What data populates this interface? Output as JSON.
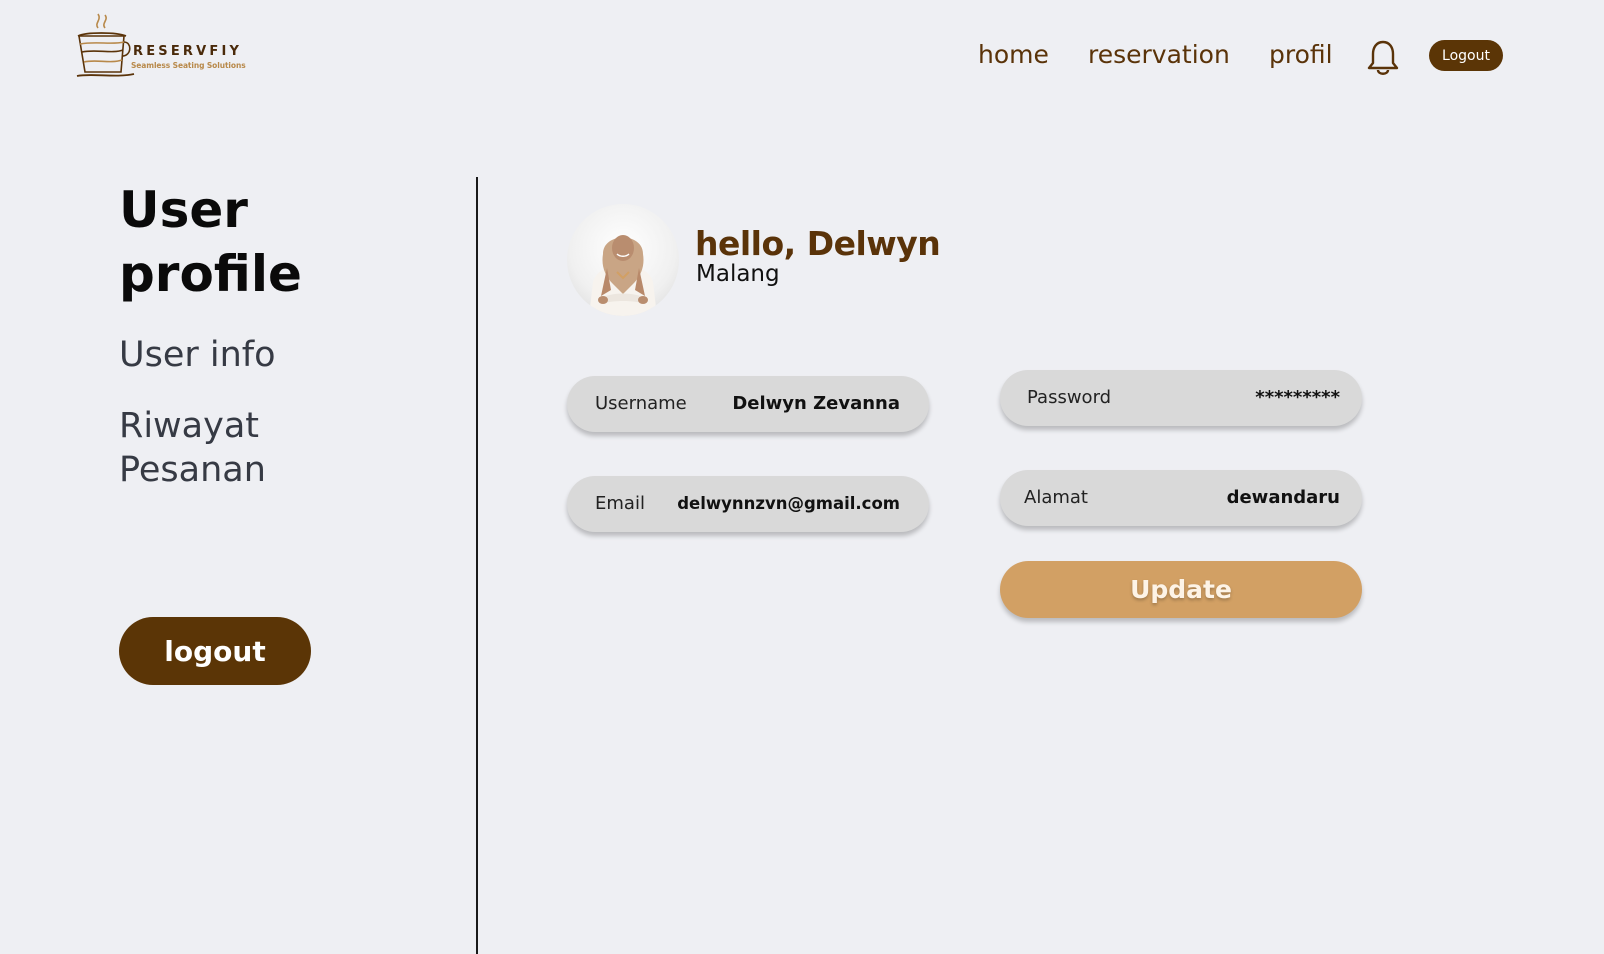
{
  "header": {
    "logo": {
      "name": "RESERVFIY",
      "tagline": "Seamless Seating Solutions"
    },
    "nav": [
      {
        "label": "home"
      },
      {
        "label": "reservation"
      },
      {
        "label": "profil"
      }
    ],
    "notification_icon": "bell-icon",
    "logout_label": "Logout"
  },
  "sidebar": {
    "title": "User profile",
    "items": [
      {
        "label": "User info"
      },
      {
        "label": "Riwayat Pesanan"
      }
    ],
    "logout_label": "logout"
  },
  "profile": {
    "greeting": "hello, Delwyn",
    "city": "Malang",
    "avatar_icon": "user-avatar-photo",
    "fields": {
      "username": {
        "label": "Username",
        "value": "Delwyn Zevanna"
      },
      "email": {
        "label": "Email",
        "value": "delwynnzvn@gmail.com"
      },
      "password": {
        "label": "Password",
        "value": "*********"
      },
      "alamat": {
        "label": "Alamat",
        "value": "dewandaru"
      }
    },
    "update_label": "Update"
  },
  "colors": {
    "brand_brown": "#5b3506",
    "accent_tan": "#d2a064",
    "background": "#eeeff3",
    "field_gray": "#d9d9d9"
  }
}
